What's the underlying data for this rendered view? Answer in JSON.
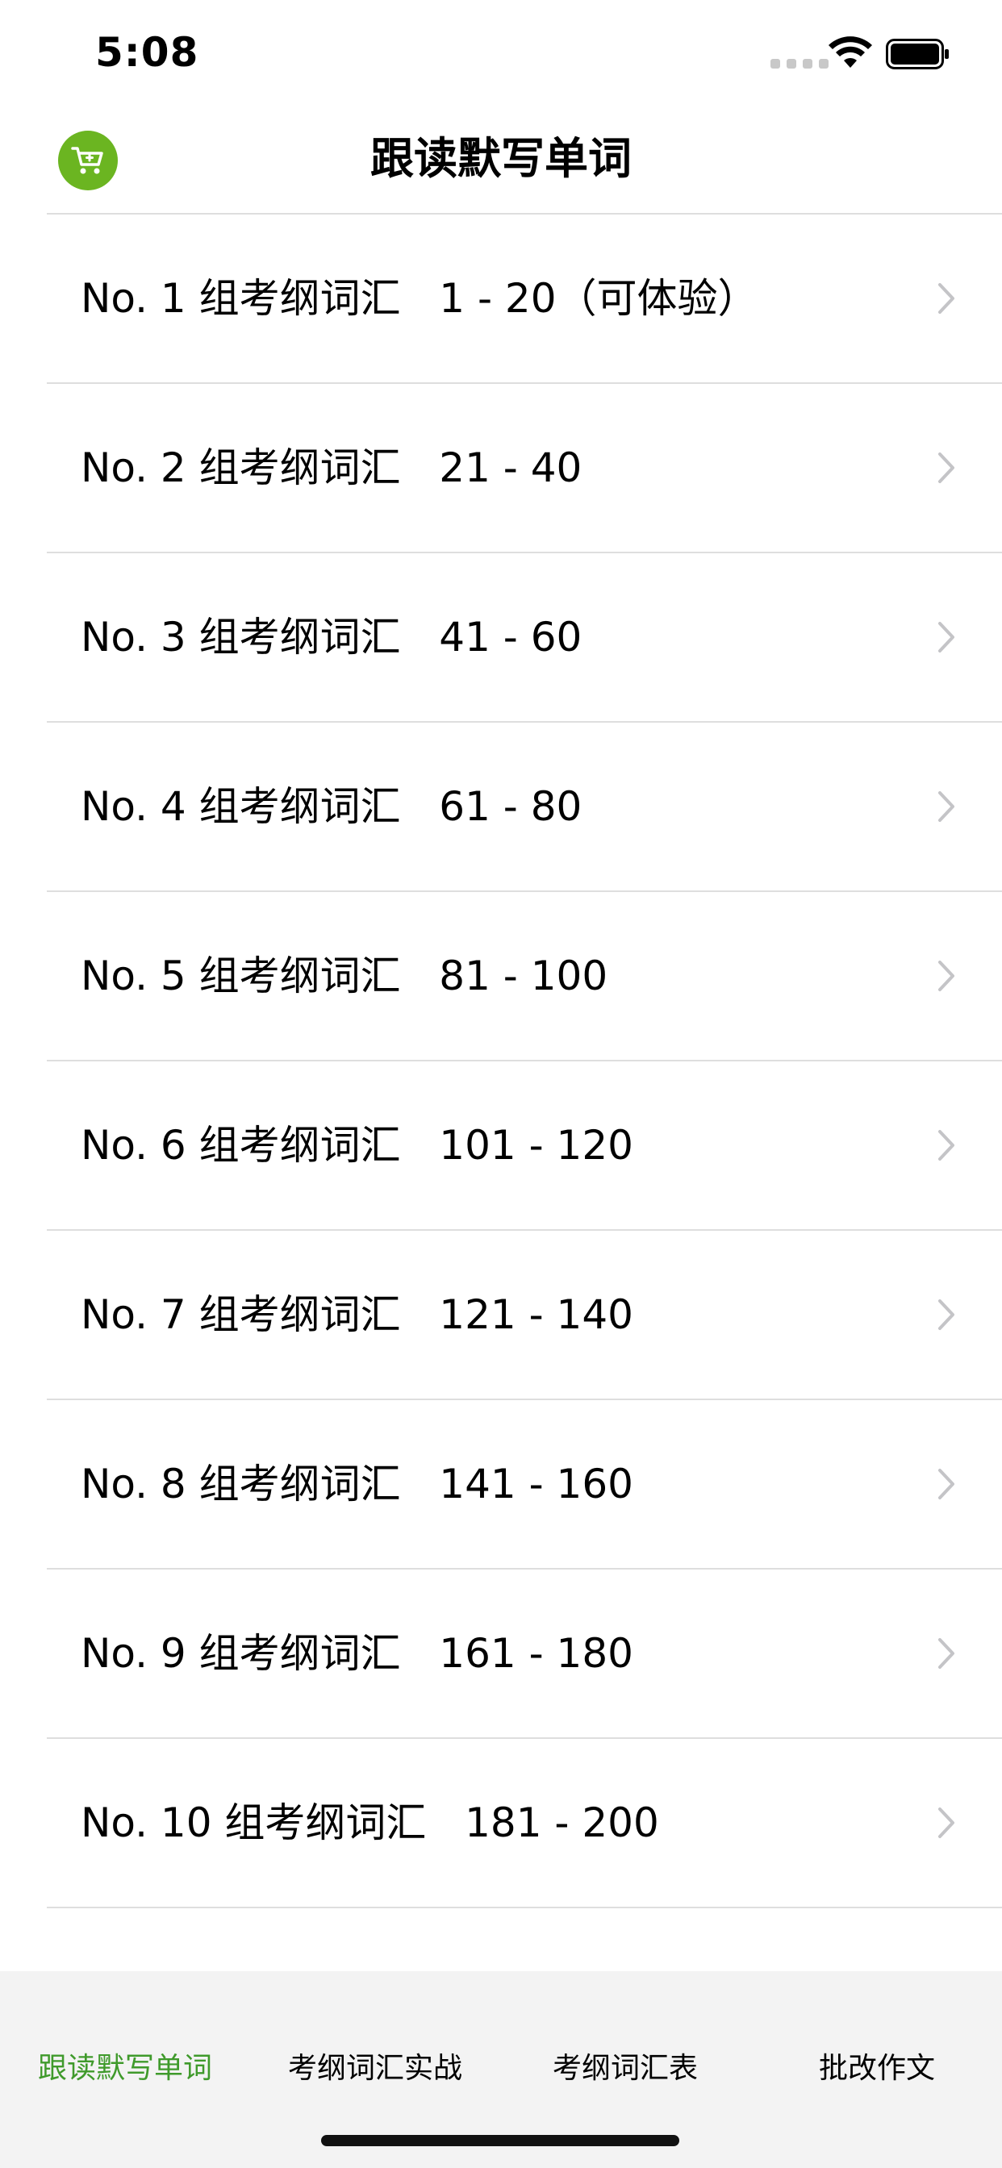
{
  "status_bar": {
    "time": "5:08"
  },
  "nav": {
    "title": "跟读默写单词",
    "cart_icon": "cart-icon",
    "accent_color": "#6bb521"
  },
  "list": {
    "items": [
      {
        "label": "No. 1 组考纲词汇   1 - 20（可体验）"
      },
      {
        "label": "No. 2 组考纲词汇   21 - 40"
      },
      {
        "label": "No. 3 组考纲词汇   41 - 60"
      },
      {
        "label": "No. 4 组考纲词汇   61 - 80"
      },
      {
        "label": "No. 5 组考纲词汇   81 - 100"
      },
      {
        "label": "No. 6 组考纲词汇   101 - 120"
      },
      {
        "label": "No. 7 组考纲词汇   121 - 140"
      },
      {
        "label": "No. 8 组考纲词汇   141 - 160"
      },
      {
        "label": "No. 9 组考纲词汇   161 - 180"
      },
      {
        "label": "No. 10 组考纲词汇   181 - 200"
      }
    ]
  },
  "tab_bar": {
    "tabs": [
      {
        "label": "跟读默写单词",
        "active": true
      },
      {
        "label": "考纲词汇实战",
        "active": false
      },
      {
        "label": "考纲词汇表",
        "active": false
      },
      {
        "label": "批改作文",
        "active": false
      }
    ],
    "active_color": "#3f9a2b"
  }
}
